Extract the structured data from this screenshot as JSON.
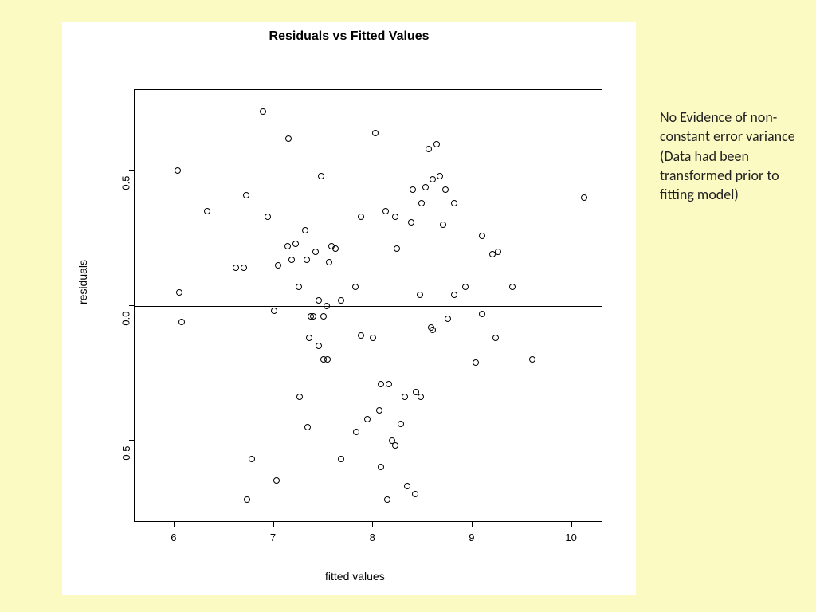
{
  "annotation": "No Evidence of non-constant error variance (Data had been transformed prior to fitting model)",
  "chart_data": {
    "type": "scatter",
    "title": "Residuals vs Fitted Values",
    "xlabel": "fitted values",
    "ylabel": "residuals",
    "xlim": [
      5.6,
      10.3
    ],
    "ylim": [
      -0.8,
      0.8
    ],
    "x_ticks": [
      6,
      7,
      8,
      9,
      10
    ],
    "y_ticks": [
      -0.5,
      0.0,
      0.5
    ],
    "reference_lines": [
      {
        "axis": "y",
        "value": 0
      }
    ],
    "series": [
      {
        "name": "residuals",
        "points": [
          {
            "x": 6.03,
            "y": 0.5
          },
          {
            "x": 6.05,
            "y": 0.05
          },
          {
            "x": 6.07,
            "y": -0.06
          },
          {
            "x": 6.33,
            "y": 0.35
          },
          {
            "x": 6.62,
            "y": 0.14
          },
          {
            "x": 6.7,
            "y": 0.14
          },
          {
            "x": 6.72,
            "y": 0.41
          },
          {
            "x": 6.73,
            "y": -0.72
          },
          {
            "x": 6.78,
            "y": -0.57
          },
          {
            "x": 6.89,
            "y": 0.72
          },
          {
            "x": 6.94,
            "y": 0.33
          },
          {
            "x": 7.0,
            "y": -0.02
          },
          {
            "x": 7.03,
            "y": -0.65
          },
          {
            "x": 7.04,
            "y": 0.15
          },
          {
            "x": 7.14,
            "y": 0.22
          },
          {
            "x": 7.15,
            "y": 0.62
          },
          {
            "x": 7.18,
            "y": 0.17
          },
          {
            "x": 7.22,
            "y": 0.23
          },
          {
            "x": 7.25,
            "y": 0.07
          },
          {
            "x": 7.26,
            "y": -0.34
          },
          {
            "x": 7.32,
            "y": 0.28
          },
          {
            "x": 7.33,
            "y": 0.17
          },
          {
            "x": 7.34,
            "y": -0.45
          },
          {
            "x": 7.36,
            "y": -0.12
          },
          {
            "x": 7.37,
            "y": -0.04
          },
          {
            "x": 7.4,
            "y": -0.04
          },
          {
            "x": 7.42,
            "y": 0.2
          },
          {
            "x": 7.45,
            "y": 0.02
          },
          {
            "x": 7.45,
            "y": -0.15
          },
          {
            "x": 7.48,
            "y": 0.48
          },
          {
            "x": 7.5,
            "y": -0.04
          },
          {
            "x": 7.5,
            "y": -0.2
          },
          {
            "x": 7.53,
            "y": 0.0
          },
          {
            "x": 7.54,
            "y": -0.2
          },
          {
            "x": 7.56,
            "y": 0.16
          },
          {
            "x": 7.58,
            "y": 0.22
          },
          {
            "x": 7.62,
            "y": 0.21
          },
          {
            "x": 7.68,
            "y": 0.02
          },
          {
            "x": 7.68,
            "y": -0.57
          },
          {
            "x": 7.82,
            "y": 0.07
          },
          {
            "x": 7.83,
            "y": -0.47
          },
          {
            "x": 7.88,
            "y": -0.11
          },
          {
            "x": 7.88,
            "y": 0.33
          },
          {
            "x": 7.94,
            "y": -0.42
          },
          {
            "x": 8.0,
            "y": -0.12
          },
          {
            "x": 8.02,
            "y": 0.64
          },
          {
            "x": 8.06,
            "y": -0.39
          },
          {
            "x": 8.08,
            "y": -0.6
          },
          {
            "x": 8.08,
            "y": -0.29
          },
          {
            "x": 8.13,
            "y": 0.35
          },
          {
            "x": 8.14,
            "y": -0.72
          },
          {
            "x": 8.16,
            "y": -0.29
          },
          {
            "x": 8.19,
            "y": -0.5
          },
          {
            "x": 8.22,
            "y": 0.33
          },
          {
            "x": 8.22,
            "y": -0.52
          },
          {
            "x": 8.24,
            "y": 0.21
          },
          {
            "x": 8.28,
            "y": -0.44
          },
          {
            "x": 8.32,
            "y": -0.34
          },
          {
            "x": 8.34,
            "y": -0.67
          },
          {
            "x": 8.38,
            "y": 0.31
          },
          {
            "x": 8.4,
            "y": 0.43
          },
          {
            "x": 8.42,
            "y": -0.7
          },
          {
            "x": 8.43,
            "y": -0.32
          },
          {
            "x": 8.47,
            "y": 0.04
          },
          {
            "x": 8.48,
            "y": -0.34
          },
          {
            "x": 8.49,
            "y": 0.38
          },
          {
            "x": 8.53,
            "y": 0.44
          },
          {
            "x": 8.56,
            "y": 0.58
          },
          {
            "x": 8.58,
            "y": -0.08
          },
          {
            "x": 8.6,
            "y": -0.09
          },
          {
            "x": 8.6,
            "y": 0.47
          },
          {
            "x": 8.64,
            "y": 0.6
          },
          {
            "x": 8.67,
            "y": 0.48
          },
          {
            "x": 8.7,
            "y": 0.3
          },
          {
            "x": 8.73,
            "y": 0.43
          },
          {
            "x": 8.75,
            "y": -0.05
          },
          {
            "x": 8.82,
            "y": 0.38
          },
          {
            "x": 8.82,
            "y": 0.04
          },
          {
            "x": 8.93,
            "y": 0.07
          },
          {
            "x": 9.03,
            "y": -0.21
          },
          {
            "x": 9.1,
            "y": 0.26
          },
          {
            "x": 9.1,
            "y": -0.03
          },
          {
            "x": 9.2,
            "y": 0.19
          },
          {
            "x": 9.23,
            "y": -0.12
          },
          {
            "x": 9.26,
            "y": 0.2
          },
          {
            "x": 9.4,
            "y": 0.07
          },
          {
            "x": 9.6,
            "y": -0.2
          },
          {
            "x": 10.12,
            "y": 0.4
          }
        ]
      }
    ]
  }
}
